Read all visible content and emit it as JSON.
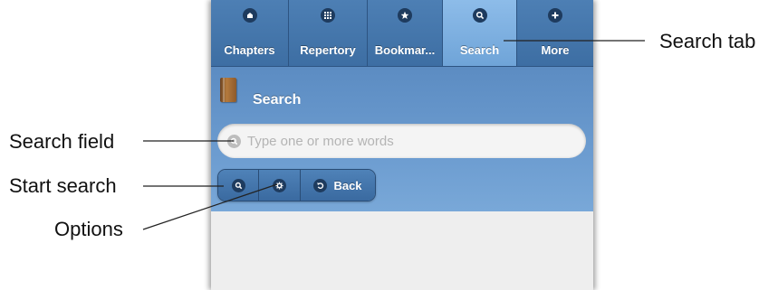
{
  "tabs": [
    {
      "label": "Chapters",
      "icon": "chapters-icon"
    },
    {
      "label": "Repertory",
      "icon": "grid-icon"
    },
    {
      "label": "Bookmar...",
      "icon": "star-icon"
    },
    {
      "label": "Search",
      "icon": "search-icon",
      "active": true
    },
    {
      "label": "More",
      "icon": "plus-icon"
    }
  ],
  "header": {
    "title": "Search"
  },
  "search": {
    "placeholder": "Type one or more words",
    "value": ""
  },
  "buttons": {
    "back_label": "Back"
  },
  "annotations": {
    "search_tab": "Search tab",
    "search_field": "Search field",
    "start_search": "Start search",
    "options": "Options"
  },
  "colors": {
    "tabbar": "#3d6ea3",
    "tab_active": "#7fb0e0",
    "header": "#6c9cd0",
    "icon_bg": "#1e3b5e",
    "content": "#eeeeee"
  }
}
